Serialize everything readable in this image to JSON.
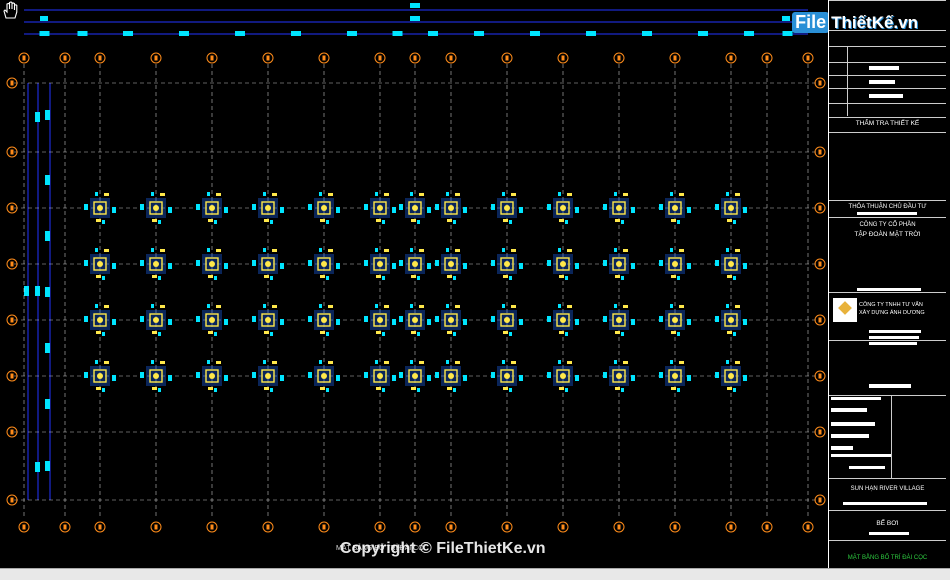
{
  "title_block": {
    "review_label": "THẨM TRA THIẾT KẾ",
    "owner_approval_label": "THỎA THUẬN CHỦ ĐẦU TƯ",
    "owner_company_line1": "CÔNG TY CỔ PHẦN",
    "owner_company_line2": "TẬP ĐOÀN MẶT TRỜI",
    "consultant_line1": "CÔNG TY TNHH TƯ VẤN",
    "consultant_line2": "XÂY DỰNG ÁNH DƯƠNG",
    "project_name": "SUN HẠN RIVER VILLAGE",
    "item_name": "BỂ BƠI",
    "drawing_title": "MẶT BẰNG BỐ TRÍ ĐÀI CỌC"
  },
  "watermark": {
    "logo_file": "File",
    "logo_rest": "ThiếtKế.vn",
    "copyright": "Copyright © FileThietKe.vn"
  },
  "grid": {
    "columns": 15,
    "rows": 8,
    "pile_columns": 13,
    "pile_rows": 4
  },
  "colors": {
    "background": "#000000",
    "grid_line": "#ffffff",
    "axis_bubble": "#ff8c1a",
    "pile": "#ffe84a",
    "pile_glow": "#1e6bff",
    "dimension": "#00e5ff",
    "dimension_line": "#2233ff"
  },
  "icons": {
    "pan": "hand-pan-icon"
  }
}
